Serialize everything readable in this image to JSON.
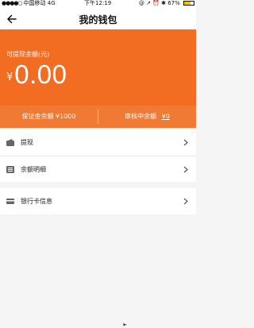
{
  "status_bar": {
    "signal_dots": "●●●●○",
    "carrier": "中国移动",
    "network": "4G",
    "time": "下午12:19",
    "indicators": "@ ↗ ⏰ ✱",
    "battery_text": "67%",
    "battery_level": 0.67
  },
  "nav": {
    "title": "我的钱包",
    "back_icon": "arrow-left-icon"
  },
  "balance": {
    "label": "可提现余额(元)",
    "currency_symbol": "¥",
    "amount": "0.00"
  },
  "deposit": {
    "left_label": "保证金余额",
    "left_value": "¥1000",
    "right_label": "审核中余额",
    "right_value": "¥0"
  },
  "menu": {
    "group1": [
      {
        "label": "提现",
        "icon": "wallet-icon"
      },
      {
        "label": "余额明细",
        "icon": "list-icon"
      }
    ],
    "group2": [
      {
        "label": "银行卡信息",
        "icon": "card-icon"
      }
    ]
  },
  "colors": {
    "accent": "#f26d22",
    "accent_light": "#f07a33",
    "background": "#f5f5f5"
  }
}
